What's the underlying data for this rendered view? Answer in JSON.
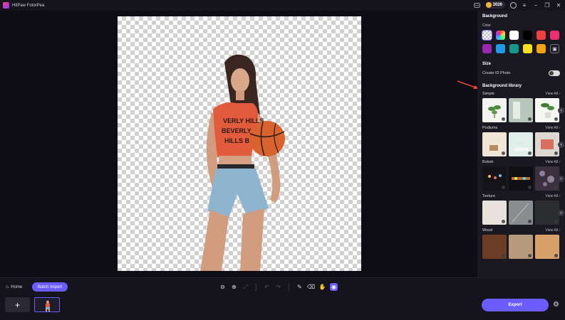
{
  "app": {
    "title": "HitPaw FotorPea",
    "credits": "3026"
  },
  "panel": {
    "background_title": "Background",
    "color_label": "Color",
    "colors": [
      "#ffffff",
      "#000000",
      "#ef4040",
      "#f02d6e",
      "#9b27b0",
      "#1e9ae6",
      "#12998c",
      "#f6e11b",
      "#f4a20f"
    ],
    "size_title": "Size",
    "create_id_photo_label": "Create ID Photo",
    "library_title": "Background library",
    "view_all": "View All",
    "categories": [
      {
        "name": "Simple"
      },
      {
        "name": "Podiums"
      },
      {
        "name": "Bokeh"
      },
      {
        "name": "Texture"
      },
      {
        "name": "Wood"
      }
    ]
  },
  "bottom": {
    "home_label": "Home",
    "batch_label": "Batch Import",
    "add_label": "+",
    "export_label": "Export"
  },
  "icons": [
    "app-logo-icon",
    "discord-icon",
    "coin-icon",
    "user-icon",
    "menu-icon",
    "minimize-icon",
    "maximize-icon",
    "close-icon",
    "home-icon",
    "zoom-out-icon",
    "zoom-in-icon",
    "fit-icon",
    "undo-icon",
    "redo-icon",
    "brush-icon",
    "eraser-icon",
    "hand-icon",
    "ai-select-icon",
    "settings-icon",
    "download-icon",
    "chevron-right-icon"
  ]
}
